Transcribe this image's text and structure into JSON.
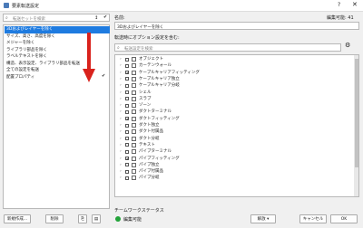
{
  "window": {
    "title": "要素転送設定",
    "help": "?",
    "close": "✕"
  },
  "left": {
    "search_placeholder": "転送セットを検索",
    "items": [
      {
        "label": "3Dおよびレイヤーを除く",
        "selected": true,
        "check": false
      },
      {
        "label": "サイズ、高さ、高度を除く",
        "selected": false,
        "check": false
      },
      {
        "label": "メジャーを除く",
        "selected": false,
        "check": false
      },
      {
        "label": "ライブラリ部品を除く",
        "selected": false,
        "check": false
      },
      {
        "label": "ラベルテキストを除く",
        "selected": false,
        "check": false
      },
      {
        "label": "構造、表示設定、ライブラリ部品を転送",
        "selected": false,
        "check": false
      },
      {
        "label": "全ての設定を転送",
        "selected": false,
        "check": false
      },
      {
        "label": "配置プロパティ",
        "selected": false,
        "check": true
      }
    ],
    "new_button": "新規作成...",
    "delete_button": "削除"
  },
  "right": {
    "name_label": "名前:",
    "edit_available": "編集可能: 41",
    "name_value": "3Dおよびレイヤーを除く",
    "elements_label": "転送時にオプション設定を含む:",
    "search_placeholder": "転送設定を検索",
    "tree": [
      {
        "label": "オブジェクト",
        "checked": false
      },
      {
        "label": "カーテンウォール",
        "checked": false
      },
      {
        "label": "ケーブルキャリアフィッティング",
        "checked": true
      },
      {
        "label": "ケーブルキャリア独立",
        "checked": false
      },
      {
        "label": "ケーブルキャリア分岐",
        "checked": false
      },
      {
        "label": "シェル",
        "checked": false
      },
      {
        "label": "スラブ",
        "checked": false
      },
      {
        "label": "ゾーン",
        "checked": false
      },
      {
        "label": "ダクトターミナル",
        "checked": false
      },
      {
        "label": "ダクトフィッティング",
        "checked": true
      },
      {
        "label": "ダクト独立",
        "checked": false
      },
      {
        "label": "ダクト付属品",
        "checked": false
      },
      {
        "label": "ダクト分岐",
        "checked": false
      },
      {
        "label": "テキスト",
        "checked": false
      },
      {
        "label": "パイプターミナル",
        "checked": false
      },
      {
        "label": "パイプフィッティング",
        "checked": true
      },
      {
        "label": "パイプ独立",
        "checked": false
      },
      {
        "label": "パイプ付属品",
        "checked": false
      },
      {
        "label": "パイプ分岐",
        "checked": false
      }
    ],
    "teamwork_label": "チームワークステータス",
    "teamwork_status": "編集可能",
    "release_button": "解放",
    "cancel_button": "キャンセル",
    "ok_button": "OK"
  },
  "colors": {
    "selection": "#1e7be0",
    "status_green": "#22a33a",
    "arrow": "#d9221c"
  }
}
